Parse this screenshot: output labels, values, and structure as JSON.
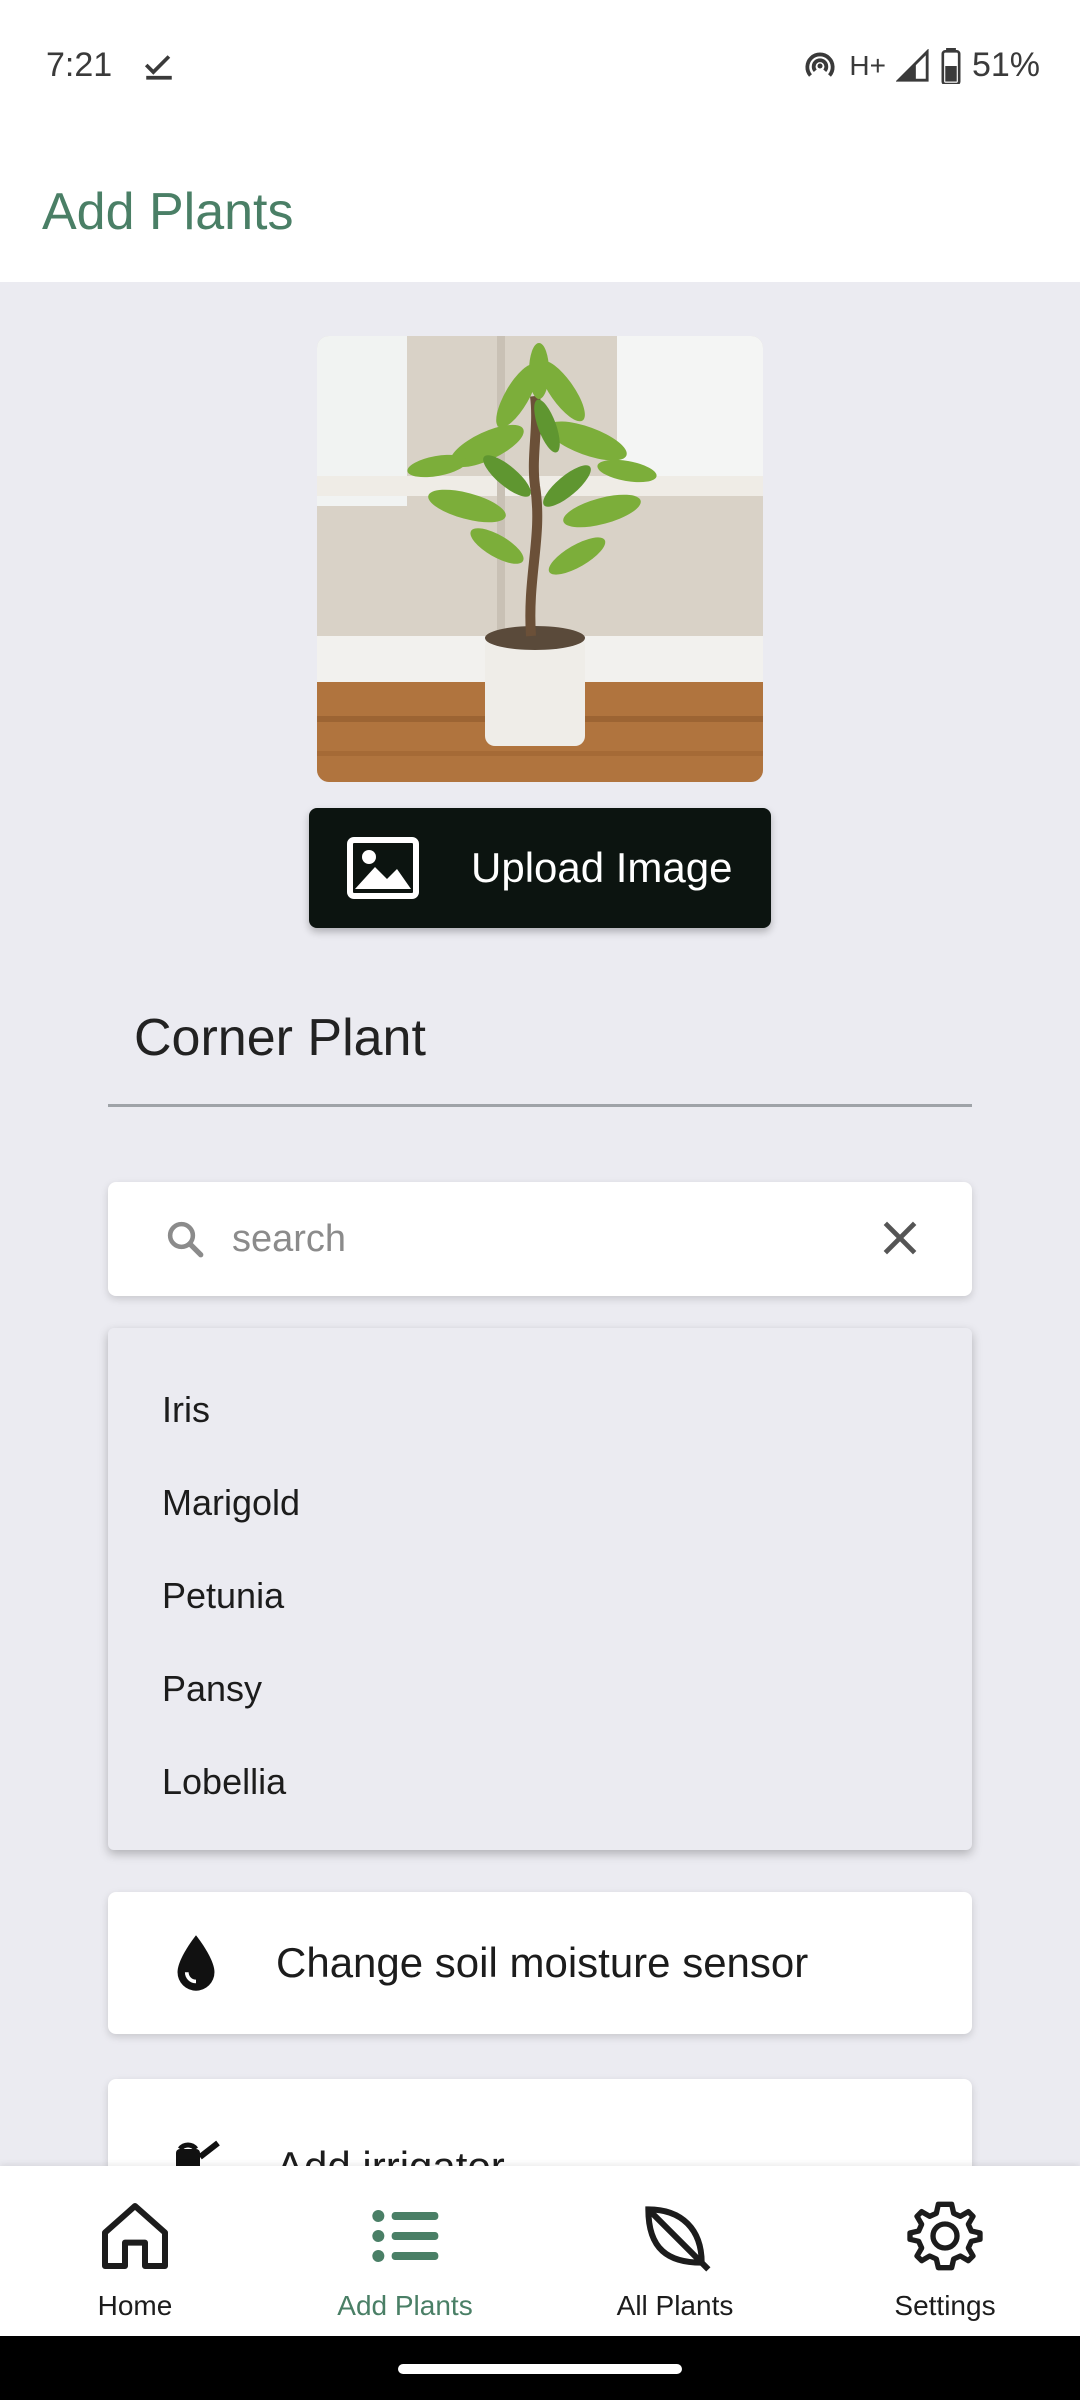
{
  "status_bar": {
    "time": "7:21",
    "network": "H+",
    "battery": "51%"
  },
  "app_bar": {
    "title": "Add Plants"
  },
  "upload_button": {
    "label": "Upload Image"
  },
  "plant_name": {
    "value": "Corner Plant"
  },
  "search": {
    "placeholder": "search",
    "value": ""
  },
  "dropdown": {
    "items": [
      "Iris",
      "Marigold",
      "Petunia",
      "Pansy",
      "Lobellia"
    ]
  },
  "cards": {
    "soil_sensor_label": "Change soil moisture sensor",
    "irrigator_label": "Add irrigator"
  },
  "bottom_nav": {
    "items": [
      {
        "label": "Home",
        "icon": "home-icon"
      },
      {
        "label": "Add Plants",
        "icon": "list-icon",
        "active": true
      },
      {
        "label": "All Plants",
        "icon": "leaf-icon"
      },
      {
        "label": "Settings",
        "icon": "gear-icon"
      }
    ]
  },
  "colors": {
    "accent": "#4a7f66",
    "background": "#ebebf1",
    "button_dark": "#0c1410"
  }
}
